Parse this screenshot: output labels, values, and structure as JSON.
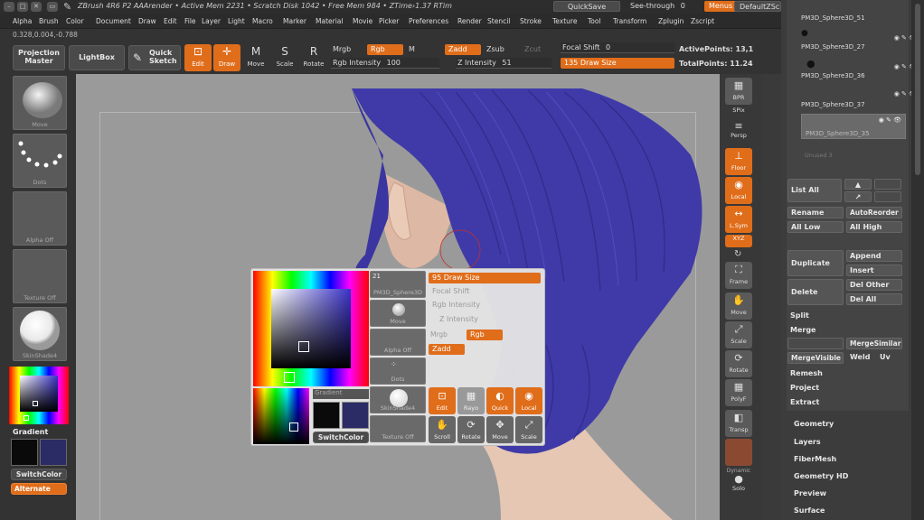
{
  "title_bar": {
    "title": "ZBrush 4R6 P2     AAArender    • Active Mem 2231  • Scratch Disk 1042  • Free Mem 984  • ZTime›1.37 RTim",
    "quicksave": "QuickSave",
    "see_through_label": "See-through",
    "see_through_value": "0",
    "menus": "Menus",
    "default_zscript": "DefaultZScript"
  },
  "menu_bar": [
    "Alpha",
    "Brush",
    "Color",
    "Document",
    "Draw",
    "Edit",
    "File",
    "Layer",
    "Light",
    "Macro",
    "Marker",
    "Material",
    "Movie",
    "Picker",
    "Preferences",
    "Render",
    "Stencil",
    "Stroke",
    "Texture",
    "Tool",
    "Transform",
    "Zplugin",
    "Zscript"
  ],
  "coords": "0.328,0.004,-0.788",
  "toolbar": {
    "projection_master": "Projection Master",
    "lightbox": "LightBox",
    "quick_sketch": "Quick Sketch",
    "edit": "Edit",
    "draw": "Draw",
    "move": "Move",
    "scale": "Scale",
    "rotate": "Rotate",
    "mrgb": "Mrgb",
    "rgb": "Rgb",
    "m": "M",
    "zadd": "Zadd",
    "zsub": "Zsub",
    "zcut": "Zcut",
    "rgb_intensity": "Rgb Intensity",
    "rgb_intensity_value": "100",
    "z_intensity": "Z Intensity",
    "z_intensity_value": "51",
    "focal_shift": "Focal Shift",
    "focal_shift_value": "0",
    "draw_size": "135 Draw Size",
    "active_points": "ActivePoints: 13,1",
    "total_points": "TotalPoints: 11.24"
  },
  "left_shelf": {
    "brush": "Move",
    "stroke": "Dots",
    "alpha": "Alpha Off",
    "texture": "Texture Off",
    "material": "SkinShade4",
    "gradient": "Gradient",
    "switch_color": "SwitchColor",
    "alternate": "Alternate"
  },
  "right_shelf": [
    {
      "id": "bpr",
      "label": "BPR"
    },
    {
      "id": "spix",
      "label": "SPix"
    },
    {
      "id": "persp",
      "label": "Persp"
    },
    {
      "id": "floor",
      "label": "Floor"
    },
    {
      "id": "local",
      "label": "Local"
    },
    {
      "id": "lsym",
      "label": "L.Sym"
    },
    {
      "id": "xyz",
      "label": "XYZ"
    },
    {
      "id": "frame",
      "label": "Frame"
    },
    {
      "id": "move",
      "label": "Move"
    },
    {
      "id": "scale",
      "label": "Scale"
    },
    {
      "id": "rotate",
      "label": "Rotate"
    },
    {
      "id": "polyf",
      "label": "PolyF"
    },
    {
      "id": "transp",
      "label": "Transp"
    },
    {
      "id": "ghost",
      "label": "Dynamic"
    },
    {
      "id": "solo",
      "label": "Solo"
    }
  ],
  "subtools": [
    "PM3D_Sphere3D_51",
    "PM3D_Sphere3D_27",
    "PM3D_Sphere3D_36",
    "PM3D_Sphere3D_37",
    "PM3D_Sphere3D_35",
    "Unused 3"
  ],
  "subtool_panel": {
    "list_all": "List All",
    "rename": "Rename",
    "auto_reorder": "AutoReorder",
    "all_low": "All Low",
    "all_high": "All High",
    "duplicate": "Duplicate",
    "append": "Append",
    "insert": "Insert",
    "delete": "Delete",
    "del_other": "Del Other",
    "del_all": "Del All",
    "split": "Split",
    "merge": "Merge",
    "merge_similar": "MergeSimilar",
    "merge_visible": "MergeVisible",
    "weld": "Weld",
    "uv": "Uv",
    "remesh": "Remesh",
    "project": "Project",
    "extract": "Extract"
  },
  "tool_sections": [
    "Geometry",
    "Layers",
    "FiberMesh",
    "Geometry HD",
    "Preview",
    "Surface"
  ],
  "popup": {
    "tool_name": "PM3D_Sphere3D",
    "tool_count": "21",
    "move": "Move",
    "alpha_off": "Alpha Off",
    "dots": "Dots",
    "skinshade": "SkinShade4",
    "texture_off": "Texture Off",
    "gradient": "Gradient",
    "switch_color": "SwitchColor",
    "draw_size": "95 Draw Size",
    "focal_shift": "Focal Shift",
    "rgb_intensity": "Rgb Intensity",
    "z_intensity": "Z Intensity",
    "mrgb": "Mrgb",
    "rgb": "Rgb",
    "zadd": "Zadd",
    "edit": "Edit",
    "rayo": "Rayo",
    "quick": "Quick",
    "local": "Local",
    "scroll": "Scroll",
    "rotate": "Rotate",
    "move2": "Move",
    "scale": "Scale"
  },
  "colors": {
    "accent": "#e06d1a",
    "hair": "#3f3aa8",
    "skin": "#e6c7b4",
    "viewport": "#9a9a9a",
    "secondary_color": "#2b2b66"
  }
}
